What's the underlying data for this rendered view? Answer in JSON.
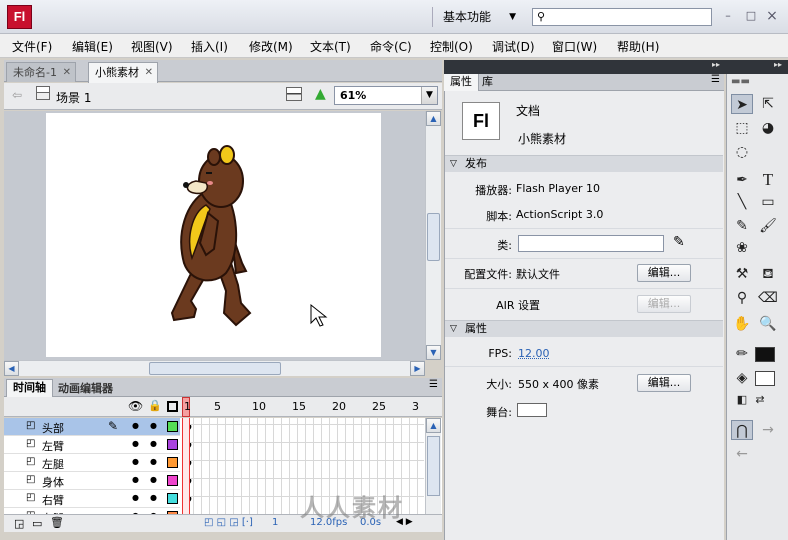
{
  "titlebar": {
    "logo": "Fl",
    "workspace": "基本功能",
    "search_placeholder": "",
    "minimize": "–",
    "maximize": "□",
    "close": "×"
  },
  "menu": [
    "文件(F)",
    "编辑(E)",
    "视图(V)",
    "插入(I)",
    "修改(M)",
    "文本(T)",
    "命令(C)",
    "控制(O)",
    "调试(D)",
    "窗口(W)",
    "帮助(H)"
  ],
  "doc_tabs": [
    {
      "label": "未命名-1"
    },
    {
      "label": "小熊素材"
    }
  ],
  "scene": {
    "label": "场景 1",
    "zoom": "61%"
  },
  "timeline": {
    "tabs": [
      "时间轴",
      "动画编辑器"
    ],
    "frame_numbers": [
      "1",
      "5",
      "10",
      "15",
      "20",
      "25",
      "3"
    ],
    "layers": [
      {
        "name": "头部",
        "color": "#55dd55",
        "selected": true
      },
      {
        "name": "左臂",
        "color": "#aa44dd"
      },
      {
        "name": "左腿",
        "color": "#ff9933"
      },
      {
        "name": "身体",
        "color": "#ee44cc"
      },
      {
        "name": "右臂",
        "color": "#44dddd"
      },
      {
        "name": "右腿",
        "color": "#ff8844"
      }
    ],
    "footer": {
      "frame": "1",
      "fps": "12.0fps",
      "time": "0.0s"
    }
  },
  "properties": {
    "tabs": [
      "属性",
      "库"
    ],
    "doc_icon": "Fl",
    "doc_type": "文档",
    "doc_name": "小熊素材",
    "publish_section": "发布",
    "player_label": "播放器:",
    "player_value": "Flash Player 10",
    "script_label": "脚本:",
    "script_value": "ActionScript 3.0",
    "class_label": "类:",
    "class_value": "",
    "profile_label": "配置文件:",
    "profile_value": "默认文件",
    "edit_label": "编辑...",
    "air_label": "AIR 设置",
    "props_section": "属性",
    "fps_label": "FPS:",
    "fps_value": "12.00",
    "size_label": "大小:",
    "size_value": "550 x 400 像素",
    "stage_label": "舞台:"
  },
  "watermark": "人人素材",
  "colors": {
    "accent": "#c8102e",
    "layer_selected": "#a9c4e8",
    "stage_bg": "#ffffff",
    "stroke_color": "#000000",
    "fill_color": "#ffffff"
  }
}
